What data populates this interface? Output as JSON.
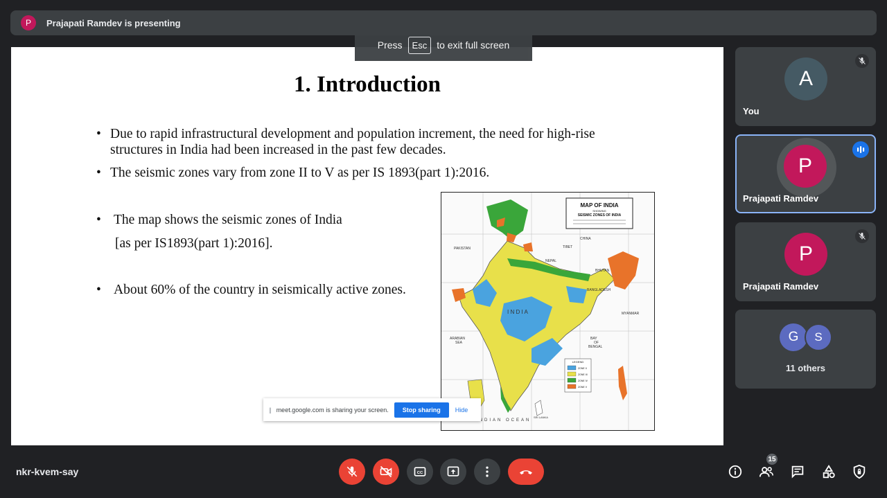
{
  "presenter_bar": {
    "avatar_letter": "P",
    "text": "Prajapati Ramdev is presenting"
  },
  "fullscreen_toast": {
    "press": "Press",
    "key": "Esc",
    "suffix": "to exit full screen"
  },
  "slide": {
    "title": "1. Introduction",
    "bullets": [
      "Due to rapid infrastructural development and population increment, the need for high-rise",
      "structures in India had been increased in the past few decades.",
      "The seismic zones vary from zone II to V as per IS 1893(part 1):2016.",
      "The map shows the seismic zones of India",
      "[as per IS1893(part 1):2016].",
      "About 60% of the country in seismically active zones."
    ],
    "map": {
      "title": "MAP OF INDIA",
      "subtitle1": "SHOWING",
      "subtitle2": "SEISMIC ZONES OF INDIA",
      "labels": [
        "CHINA",
        "PAKISTAN",
        "TIBET",
        "NEPAL",
        "BHUTAN",
        "BANGLADESH",
        "MYANMAR",
        "ARABIAN",
        "SEA",
        "BAY",
        "OF",
        "BENGAL",
        "I N D I A",
        "INDIAN OCEAN",
        "LEGEND",
        "SRI LANKA"
      ],
      "legend": [
        "ZONE II",
        "ZONE III",
        "ZONE IV",
        "ZONE V"
      ],
      "zone_colors": {
        "zone2": "#4aa3df",
        "zone3": "#e8e04a",
        "zone4": "#3aa63a",
        "zone5": "#e8732a"
      }
    }
  },
  "share_bar": {
    "handle": "||",
    "text": "meet.google.com is sharing your screen.",
    "stop": "Stop sharing",
    "hide": "Hide"
  },
  "participants": [
    {
      "letter": "A",
      "name": "You",
      "color": "#455a64"
    },
    {
      "letter": "P",
      "name": "Prajapati Ramdev",
      "color": "#c2185b"
    },
    {
      "letter": "P",
      "name": "Prajapati Ramdev",
      "color": "#c2185b"
    }
  ],
  "others": {
    "letters": [
      "G",
      "S"
    ],
    "colors": [
      "#5c6bc0",
      "#5c6bc0"
    ],
    "label": "11 others"
  },
  "meeting_code": "nkr-kvem-say",
  "people_count": "15",
  "colors": {
    "end_call": "#ea4335",
    "control": "#3c4043",
    "accent": "#1a73e8",
    "highlight_border": "#8ab4f8"
  }
}
